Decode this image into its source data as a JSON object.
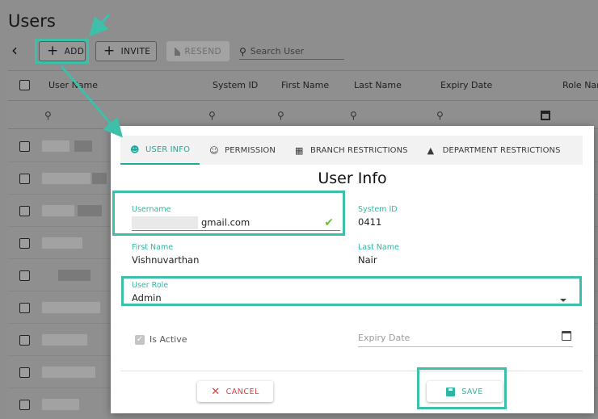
{
  "page": {
    "title": "Users"
  },
  "toolbar": {
    "add_label": "ADD",
    "invite_label": "INVITE",
    "resend_label": "RESEND",
    "search_placeholder": "Search User"
  },
  "grid": {
    "columns": [
      "User Name",
      "System ID",
      "First Name",
      "Last Name",
      "Expiry Date",
      "Role Nam"
    ]
  },
  "modal": {
    "tabs": [
      "USER INFO",
      "PERMISSION",
      "BRANCH RESTRICTIONS",
      "DEPARTMENT RESTRICTIONS"
    ],
    "title": "User Info",
    "username": {
      "label": "Username",
      "value": "gmail.com"
    },
    "system_id": {
      "label": "System ID",
      "value": "0411"
    },
    "first_name": {
      "label": "First Name",
      "value": "Vishnuvarthan"
    },
    "last_name": {
      "label": "Last Name",
      "value": "Nair"
    },
    "user_role": {
      "label": "User Role",
      "value": "Admin"
    },
    "is_active": {
      "label": "Is Active",
      "checked": true
    },
    "expiry_date": {
      "placeholder": "Expiry Date"
    },
    "cancel_label": "CANCEL",
    "save_label": "SAVE"
  },
  "colors": {
    "accent": "#2eb7a0",
    "highlight": "#3dbfaa",
    "cancel": "#e23b3b",
    "valid": "#6cbf3a"
  },
  "icons": [
    "back-icon",
    "plus-icon",
    "mail-icon",
    "search-icon",
    "calendar-icon",
    "user-info-icon",
    "permission-icon",
    "branch-icon",
    "department-icon",
    "check-icon",
    "dropdown-arrow-icon",
    "close-icon",
    "save-icon"
  ]
}
